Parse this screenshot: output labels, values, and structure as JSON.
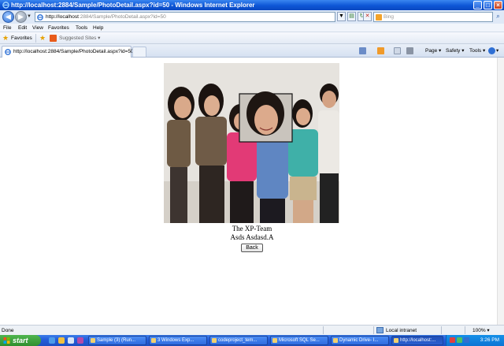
{
  "window": {
    "title": "http://localhost:2884/Sample/PhotoDetail.aspx?id=50 - Windows Internet Explorer",
    "minimize_glyph": "_",
    "maximize_glyph": "□",
    "close_glyph": "×"
  },
  "address_bar": {
    "url_host": "http://localhost",
    "url_rest": ":2884/Sample/PhotoDetail.aspx?id=50",
    "back_glyph": "◀",
    "forward_glyph": "▶",
    "dropdown_glyph": "▼",
    "refresh_glyph": "↻",
    "compat_glyph": "▤",
    "stop_glyph": "✕"
  },
  "search": {
    "placeholder": "Bing",
    "go_glyph": "⌕"
  },
  "menu": [
    "File",
    "Edit",
    "View",
    "Favorites",
    "Tools",
    "Help"
  ],
  "favorites_bar": {
    "favorites_label": "Favorites",
    "suggested_label": "Suggested Sites ▾"
  },
  "tab": {
    "label": "http://localhost:2884/Sample/PhotoDetail.aspx?id=50"
  },
  "command_bar": {
    "page_label": "Page ▾",
    "safety_label": "Safety ▾",
    "tools_label": "Tools ▾",
    "help_label": "▾"
  },
  "content": {
    "photo_title": "The XP-Team",
    "photo_description": "Asds Asdasd.A",
    "back_button_label": "Back"
  },
  "status_bar": {
    "status_text": "Done",
    "zone_text": "Local intranet",
    "zoom_text": "100%  ▾"
  },
  "taskbar": {
    "start_label": "start",
    "buttons": [
      "Sample (3) (Run...",
      "3 Windows Exp...",
      "codeproject_tem...",
      "Microsoft SQL Se...",
      "Dynamic Drive- I...",
      "http://localhost:..."
    ],
    "clock": "3:26 PM"
  },
  "colors": {
    "titlebar": "#0d56d6",
    "taskbar": "#245edb",
    "start": "#2f8f2f"
  }
}
